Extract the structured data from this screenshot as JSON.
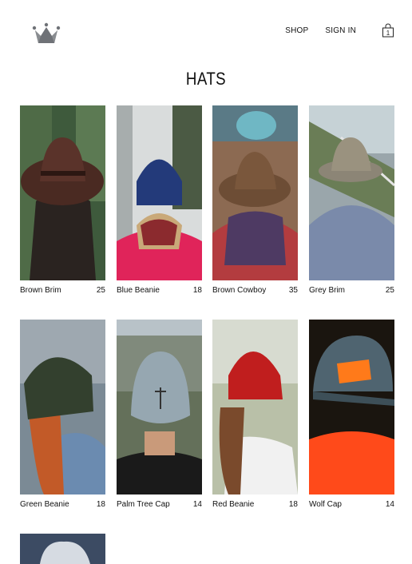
{
  "nav": {
    "logo_icon": "crown-logo-icon",
    "shop_label": "SHOP",
    "signin_label": "SIGN IN",
    "cart_icon": "shopping-bag-icon",
    "cart_count": "1"
  },
  "page": {
    "title": "HATS"
  },
  "products": [
    {
      "name": "Brown Brim",
      "price": "25"
    },
    {
      "name": "Blue Beanie",
      "price": "18"
    },
    {
      "name": "Brown Cowboy",
      "price": "35"
    },
    {
      "name": "Grey Brim",
      "price": "25"
    },
    {
      "name": "Green Beanie",
      "price": "18"
    },
    {
      "name": "Palm Tree Cap",
      "price": "14"
    },
    {
      "name": "Red Beanie",
      "price": "18"
    },
    {
      "name": "Wolf Cap",
      "price": "14"
    }
  ],
  "colors": {
    "text": "#111111",
    "background": "#ffffff",
    "logo": "#6f7277"
  }
}
